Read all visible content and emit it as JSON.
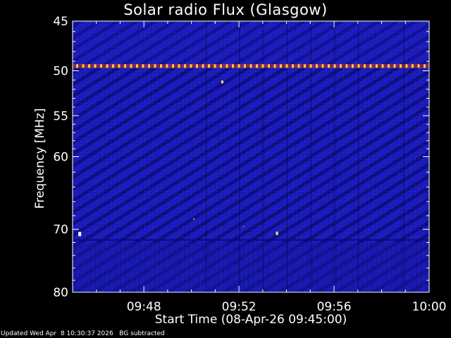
{
  "chart_data": {
    "type": "heatmap",
    "title": "Solar radio Flux (Glasgow)",
    "xlabel": "Start Time (08-Apr-26 09:45:00)",
    "ylabel": "Frequency [MHz]",
    "x_range": [
      "09:45:00",
      "10:00:00"
    ],
    "y_range": [
      45,
      80
    ],
    "x_ticks": [
      {
        "label": "09:48",
        "minutes": 3
      },
      {
        "label": "09:52",
        "minutes": 7
      },
      {
        "label": "09:56",
        "minutes": 11
      },
      {
        "label": "10:00",
        "minutes": 15
      }
    ],
    "y_ticks": [
      {
        "label": "45",
        "value": 45
      },
      {
        "label": "50",
        "value": 50
      },
      {
        "label": "55",
        "value": 55
      },
      {
        "label": "60",
        "value": 60
      },
      {
        "label": "70",
        "value": 70
      },
      {
        "label": "80",
        "value": 80
      }
    ],
    "y_scale": "log",
    "colors": {
      "background": "#000000",
      "spectrum_base": "#1a1ab4",
      "spectrum_dark": "#0a0a6e",
      "interference": "#ff8c00",
      "bright_spot": "#ffffe0",
      "axis": "#ffffff"
    }
  },
  "footer": "Updated Wed Apr  8 10:30:37 2026   BG subtracted"
}
